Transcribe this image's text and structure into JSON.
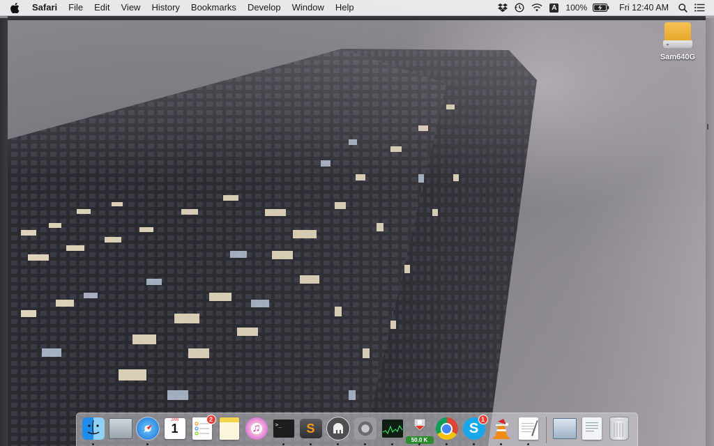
{
  "menubar": {
    "apple_icon": "apple-icon",
    "app_name": "Safari",
    "items": [
      "File",
      "Edit",
      "View",
      "History",
      "Bookmarks",
      "Develop",
      "Window",
      "Help"
    ],
    "status": {
      "dropbox_icon": "dropbox-icon",
      "timemachine_icon": "time-machine-icon",
      "wifi_icon": "wifi-icon",
      "input_source": "A",
      "battery_percent": "100%",
      "battery_icon": "battery-charging-icon",
      "clock": "Fri 12:40 AM",
      "spotlight_icon": "search-icon",
      "notification_icon": "notification-center-icon"
    }
  },
  "desktop": {
    "drive_label": "Sam640G",
    "wallpaper": "foggy skyscraper at night"
  },
  "dock": {
    "apps": [
      {
        "name": "Finder",
        "icon": "finder-icon",
        "running": true
      },
      {
        "name": "Preview window",
        "icon": "window-icon",
        "running": false
      },
      {
        "name": "Safari",
        "icon": "safari-icon",
        "running": true
      },
      {
        "name": "Calendar",
        "icon": "calendar-icon",
        "running": false,
        "month": "JAN",
        "day": "1"
      },
      {
        "name": "Reminders",
        "icon": "reminders-icon",
        "running": false,
        "badge": "2"
      },
      {
        "name": "Notes",
        "icon": "notes-icon",
        "running": false
      },
      {
        "name": "iTunes",
        "icon": "itunes-icon",
        "running": false
      },
      {
        "name": "Terminal",
        "icon": "terminal-icon",
        "running": true,
        "prompt": ">_"
      },
      {
        "name": "Sublime Text",
        "icon": "sublime-icon",
        "running": true,
        "glyph": "S"
      },
      {
        "name": "Sequel Pro",
        "icon": "elephant-icon",
        "running": true
      },
      {
        "name": "System Preferences",
        "icon": "gear-icon",
        "running": true
      },
      {
        "name": "Activity Monitor",
        "icon": "activity-monitor-icon",
        "running": true
      },
      {
        "name": "Network Monitor",
        "icon": "network-monitor-icon",
        "running": true,
        "label": "50.0 K"
      },
      {
        "name": "Google Chrome",
        "icon": "chrome-icon",
        "running": true
      },
      {
        "name": "Skype",
        "icon": "skype-icon",
        "running": true,
        "badge": "1",
        "glyph": "S"
      },
      {
        "name": "VLC",
        "icon": "vlc-icon",
        "running": true
      },
      {
        "name": "TextEdit",
        "icon": "textedit-icon",
        "running": true
      }
    ],
    "docs": [
      {
        "name": "Documents folder",
        "icon": "folder-icon"
      },
      {
        "name": "Downloads stack",
        "icon": "documents-icon"
      },
      {
        "name": "Trash",
        "icon": "trash-icon"
      }
    ]
  },
  "colors": {
    "menubar_bg": "#ececee",
    "badge": "#ee3b34",
    "network_label": "#2e8b2e",
    "drive": "#f0b43c"
  }
}
